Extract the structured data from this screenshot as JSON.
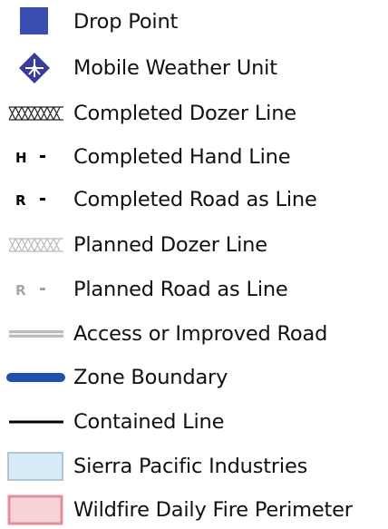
{
  "legend": {
    "items": [
      {
        "label": "Drop Point",
        "icon": "drop-point-icon",
        "color": "#3a4db0"
      },
      {
        "label": "Mobile Weather Unit",
        "icon": "mobile-weather-unit-icon",
        "color": "#3a3c9c"
      },
      {
        "label": "Completed Dozer Line",
        "icon": "completed-dozer-line-icon",
        "color": "#222222"
      },
      {
        "label": "Completed Hand Line",
        "icon": "completed-hand-line-icon",
        "color": "#000000",
        "marker": "H"
      },
      {
        "label": "Completed Road as Line",
        "icon": "completed-road-as-line-icon",
        "color": "#000000",
        "marker": "R"
      },
      {
        "label": "Planned Dozer Line",
        "icon": "planned-dozer-line-icon",
        "color": "#b9b9b9"
      },
      {
        "label": "Planned Road as Line",
        "icon": "planned-road-as-line-icon",
        "color": "#a5a5a5",
        "marker": "R"
      },
      {
        "label": "Access or Improved Road",
        "icon": "access-road-icon",
        "color": "#bdbdbd"
      },
      {
        "label": "Zone Boundary",
        "icon": "zone-boundary-icon",
        "color": "#1e4fb0"
      },
      {
        "label": "Contained Line",
        "icon": "contained-line-icon",
        "color": "#000000"
      },
      {
        "label": "Sierra Pacific Industries",
        "icon": "sierra-pacific-industries-icon",
        "fill": "#d6eaf8",
        "stroke": "#9fb6c8"
      },
      {
        "label": "Wildfire Daily Fire Perimeter",
        "icon": "fire-perimeter-icon",
        "fill": "#f7d3d6",
        "stroke": "#e58e98"
      }
    ]
  }
}
